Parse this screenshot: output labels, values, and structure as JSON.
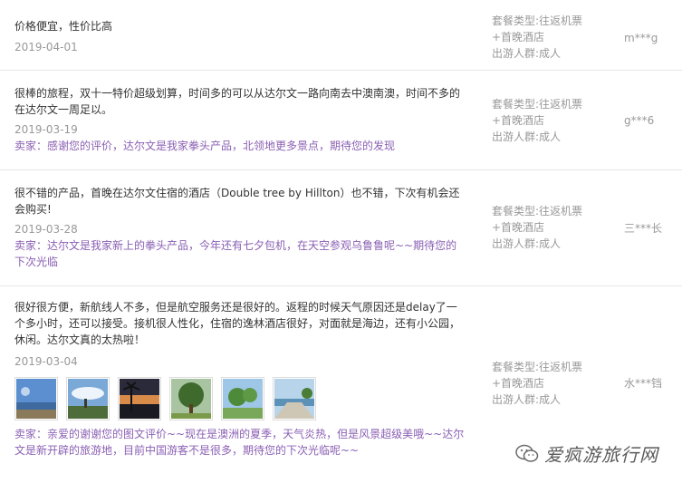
{
  "reviews": [
    {
      "text": "价格便宜，性价比高",
      "date": "2019-04-01",
      "reply": "",
      "meta": [
        "套餐类型:往返机票",
        "+首晚酒店",
        "出游人群:成人"
      ],
      "user": "m***g"
    },
    {
      "text": "很棒的旅程，双十一特价超级划算，时间多的可以从达尔文一路向南去中澳南澳，时间不多的在达尔文一周足以。",
      "date": "2019-03-19",
      "reply": "卖家：感谢您的评价，达尔文是我家拳头产品，北领地更多景点，期待您的发现",
      "meta": [
        "套餐类型:往返机票",
        "+首晚酒店",
        "出游人群:成人"
      ],
      "user": "g***6"
    },
    {
      "text": "很不错的产品，首晚在达尔文住宿的酒店（Double tree by Hillton）也不错，下次有机会还会购买!",
      "date": "2019-03-28",
      "reply": "卖家：达尔文是我家新上的拳头产品，今年还有七夕包机，在天空参观乌鲁鲁呢~~期待您的下次光临",
      "meta": [
        "套餐类型:往返机票",
        "+首晚酒店",
        "出游人群:成人"
      ],
      "user": "三***长"
    },
    {
      "text": "很好很方便，新航线人不多，但是航空服务还是很好的。返程的时候天气原因还是delay了一个多小时，还可以接受。接机很人性化，住宿的逸林酒店很好，对面就是海边，还有小公园，休闲。达尔文真的太热啦！",
      "date": "2019-03-04",
      "reply": "卖家：亲爱的谢谢您的图文评价~~现在是澳洲的夏季，天气炎热，但是风景超级美哦~~达尔文是新开辟的旅游地，目前中国游客不是很多，期待您的下次光临呢~~",
      "meta": [
        "套餐类型:往返机票",
        "+首晚酒店",
        "出游人群:成人"
      ],
      "user": "水***铛"
    }
  ],
  "photos": [
    "beach-photo",
    "sky-photo",
    "palm-sunset-photo",
    "tree-photo",
    "park-photo",
    "coast-walkway-photo"
  ],
  "watermark": {
    "text": "爱疯游旅行网",
    "icon": "wechat-icon"
  },
  "colors": {
    "reply": "#8a5fb3",
    "muted": "#999999",
    "text": "#333333",
    "divider": "#e6e6e6"
  }
}
